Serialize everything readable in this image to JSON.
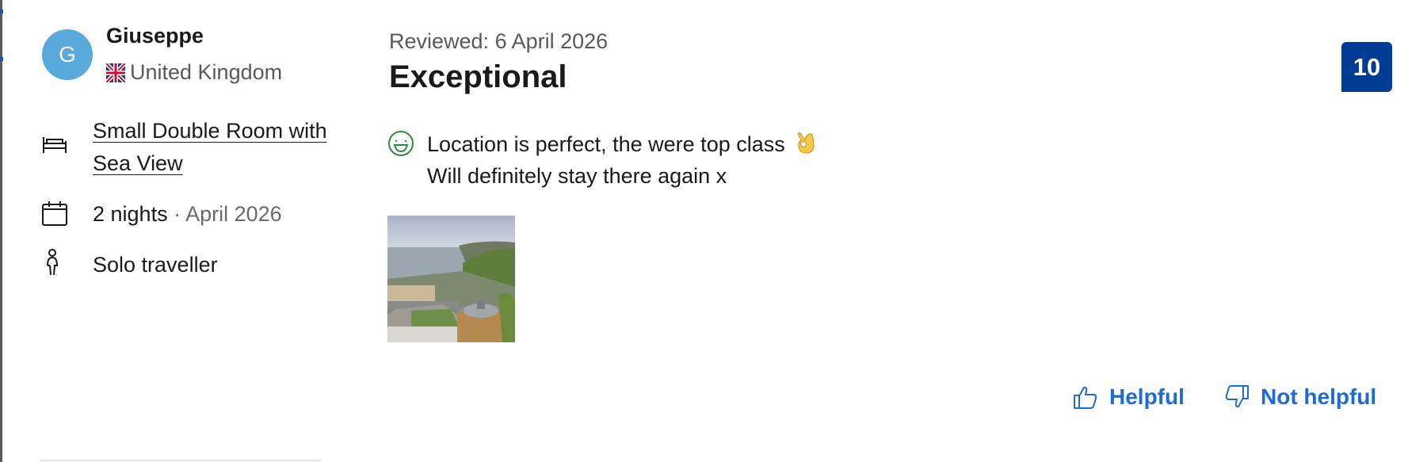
{
  "reviewer": {
    "initial": "G",
    "name": "Giuseppe",
    "country": "United Kingdom"
  },
  "stay": {
    "room": "Small Double Room with Sea View",
    "nights": "2 nights",
    "separator": "·",
    "month": "April 2026",
    "traveller_type": "Solo traveller"
  },
  "review": {
    "reviewed_date": "Reviewed: 6 April 2026",
    "title": "Exceptional",
    "positive_line1": "Location is perfect, the were top class",
    "positive_line2": "Will definitely stay there again x",
    "score": "10"
  },
  "actions": {
    "helpful_label": "Helpful",
    "not_helpful_label": "Not helpful"
  },
  "colors": {
    "avatar": "#5aa9dc",
    "score_badge": "#003b95",
    "link_blue": "#1f6bd3",
    "positive_green": "#2e8b3c"
  },
  "icons": [
    "flag-uk-icon",
    "bed-icon",
    "calendar-icon",
    "person-icon",
    "smile-icon",
    "ok-hand-emoji",
    "thumbs-up-icon",
    "thumbs-down-icon"
  ]
}
